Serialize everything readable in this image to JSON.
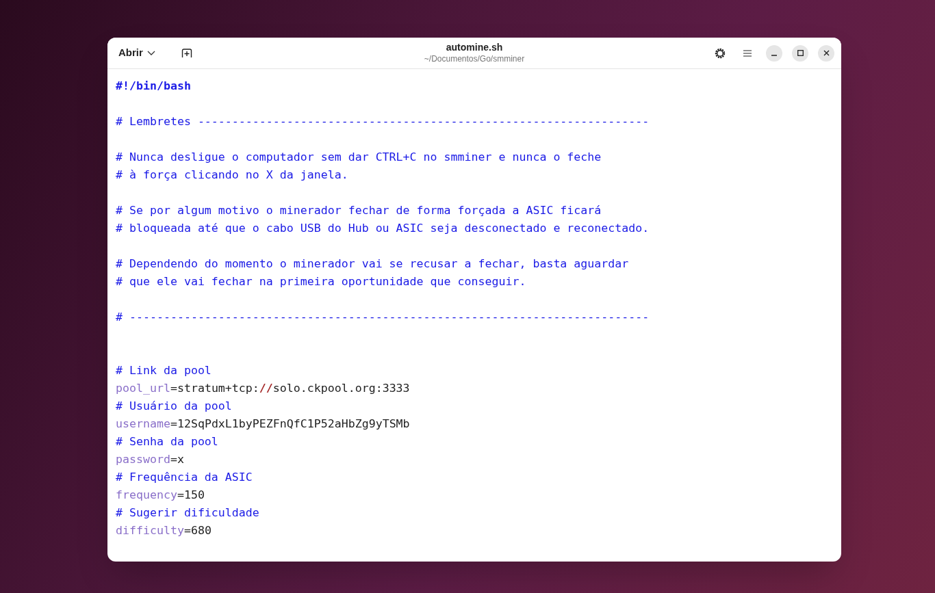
{
  "window": {
    "title": "automine.sh",
    "subtitle": "~/Documentos/Go/smminer",
    "open_button": "Abrir"
  },
  "lines": [
    {
      "kind": "code",
      "tokens": [
        {
          "kind": "shebang",
          "text": "#!/bin/bash"
        }
      ]
    },
    {
      "kind": "blank"
    },
    {
      "kind": "code",
      "tokens": [
        {
          "kind": "comment",
          "text": "# Lembretes ------------------------------------------------------------------"
        }
      ]
    },
    {
      "kind": "blank"
    },
    {
      "kind": "code",
      "tokens": [
        {
          "kind": "comment",
          "text": "# Nunca desligue o computador sem dar CTRL+C no smminer e nunca o feche"
        }
      ]
    },
    {
      "kind": "code",
      "tokens": [
        {
          "kind": "comment",
          "text": "# à força clicando no X da janela."
        }
      ]
    },
    {
      "kind": "blank"
    },
    {
      "kind": "code",
      "tokens": [
        {
          "kind": "comment",
          "text": "# Se por algum motivo o minerador fechar de forma forçada a ASIC ficará"
        }
      ]
    },
    {
      "kind": "code",
      "tokens": [
        {
          "kind": "comment",
          "text": "# bloqueada até que o cabo USB do Hub ou ASIC seja desconectado e reconectado."
        }
      ]
    },
    {
      "kind": "blank"
    },
    {
      "kind": "code",
      "tokens": [
        {
          "kind": "comment",
          "text": "# Dependendo do momento o minerador vai se recusar a fechar, basta aguardar"
        }
      ]
    },
    {
      "kind": "code",
      "tokens": [
        {
          "kind": "comment",
          "text": "# que ele vai fechar na primeira oportunidade que conseguir."
        }
      ]
    },
    {
      "kind": "blank"
    },
    {
      "kind": "code",
      "tokens": [
        {
          "kind": "comment",
          "text": "# ----------------------------------------------------------------------------"
        }
      ]
    },
    {
      "kind": "blank"
    },
    {
      "kind": "blank"
    },
    {
      "kind": "code",
      "tokens": [
        {
          "kind": "comment",
          "text": "# Link da pool"
        }
      ]
    },
    {
      "kind": "code",
      "tokens": [
        {
          "kind": "variable",
          "text": "pool_url"
        },
        {
          "kind": "plain",
          "text": "=stratum+tcp:"
        },
        {
          "kind": "special",
          "text": "//"
        },
        {
          "kind": "plain",
          "text": "solo.ckpool.org:3333"
        }
      ]
    },
    {
      "kind": "code",
      "tokens": [
        {
          "kind": "comment",
          "text": "# Usuário da pool"
        }
      ]
    },
    {
      "kind": "code",
      "tokens": [
        {
          "kind": "variable",
          "text": "username"
        },
        {
          "kind": "plain",
          "text": "=12SqPdxL1byPEZFnQfC1P52aHbZg9yTSMb"
        }
      ]
    },
    {
      "kind": "code",
      "tokens": [
        {
          "kind": "comment",
          "text": "# Senha da pool"
        }
      ]
    },
    {
      "kind": "code",
      "tokens": [
        {
          "kind": "variable",
          "text": "password"
        },
        {
          "kind": "plain",
          "text": "=x"
        }
      ]
    },
    {
      "kind": "code",
      "tokens": [
        {
          "kind": "comment",
          "text": "# Frequência da ASIC"
        }
      ]
    },
    {
      "kind": "code",
      "tokens": [
        {
          "kind": "variable",
          "text": "frequency"
        },
        {
          "kind": "plain",
          "text": "=150"
        }
      ]
    },
    {
      "kind": "code",
      "tokens": [
        {
          "kind": "comment",
          "text": "# Sugerir dificuldade"
        }
      ]
    },
    {
      "kind": "code",
      "tokens": [
        {
          "kind": "variable",
          "text": "difficulty"
        },
        {
          "kind": "plain",
          "text": "=680"
        }
      ]
    }
  ]
}
